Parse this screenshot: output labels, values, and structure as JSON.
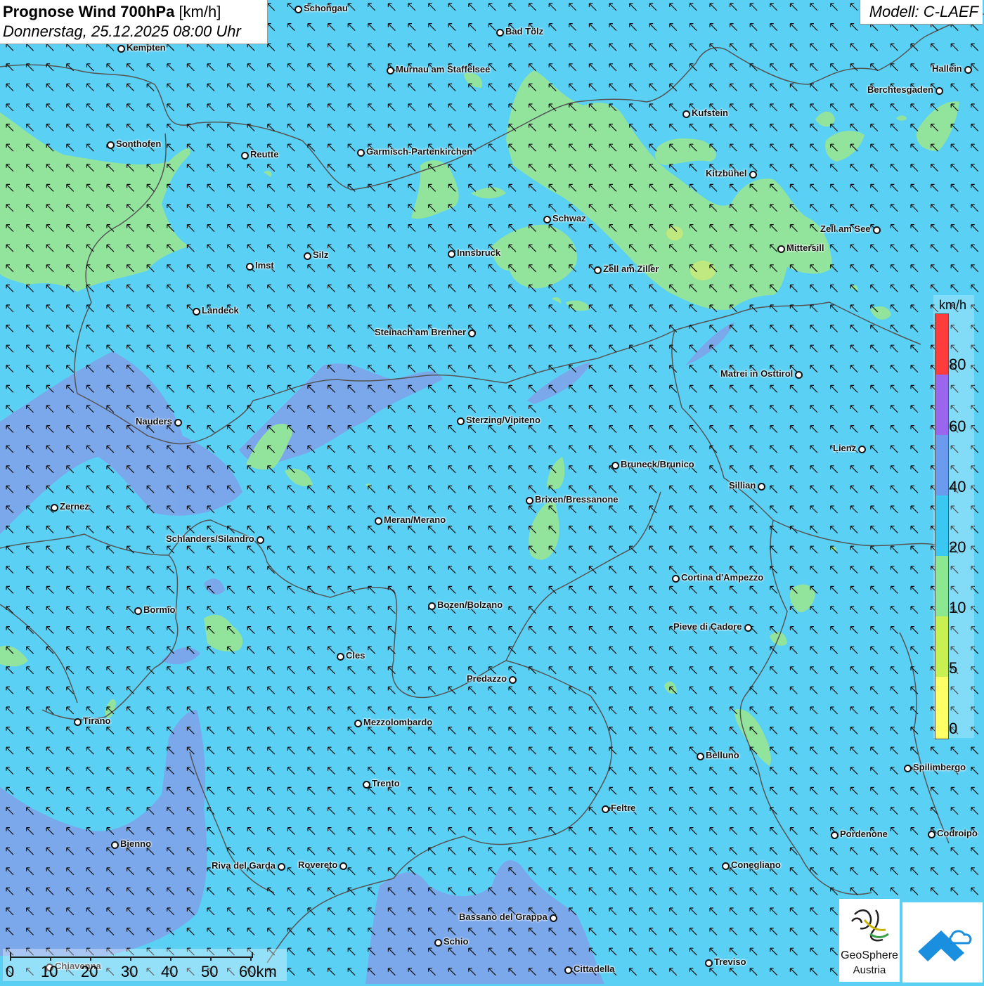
{
  "title": {
    "main_bold": "Prognose Wind 700hPa",
    "unit": "[km/h]",
    "date": "Donnerstag, 25.12.2025 08:00 Uhr"
  },
  "model": "Modell: C-LAEF",
  "legend": {
    "unit": "km/h",
    "bands": [
      {
        "value": 0,
        "color": "#ffff66"
      },
      {
        "value": 5,
        "color": "#ccf055"
      },
      {
        "value": 10,
        "color": "#88e888"
      },
      {
        "value": 20,
        "color": "#33c8f0"
      },
      {
        "value": 40,
        "color": "#6699ee"
      },
      {
        "value": 60,
        "color": "#9966ee"
      },
      {
        "value": 80,
        "color": "#ff4444"
      }
    ],
    "labels": [
      "80",
      "60",
      "40",
      "20",
      "10",
      "5",
      "0"
    ]
  },
  "scale_bar": {
    "labels": [
      "0",
      "10",
      "20",
      "30",
      "40",
      "50",
      "60km"
    ]
  },
  "logos": {
    "geosphere_line1": "GeoSphere",
    "geosphere_line2": "Austria"
  },
  "wind_direction": "from south-east (arrows pointing north-west)",
  "colors": {
    "background_20_40": "#5ad0f5",
    "zone_10_20": "#8fe39a",
    "zone_40_60": "#7e9ee8",
    "border_line": "#555555"
  },
  "cities": [
    {
      "name": "Schongau",
      "lat": 47.81,
      "lon": 10.9
    },
    {
      "name": "Bad Tölz",
      "lat": 47.76,
      "lon": 11.56
    },
    {
      "name": "Kempten",
      "lat": 47.73,
      "lon": 10.32
    },
    {
      "name": "Murnau am Staffelsee",
      "lat": 47.68,
      "lon": 11.2
    },
    {
      "name": "Hallein",
      "lat": 47.68,
      "lon": 13.1
    },
    {
      "name": "Berchtesgaden",
      "lat": 47.63,
      "lon": 13.0
    },
    {
      "name": "Kufstein",
      "lat": 47.58,
      "lon": 12.17
    },
    {
      "name": "Sonthofen",
      "lat": 47.51,
      "lon": 10.28
    },
    {
      "name": "Reutte",
      "lat": 47.49,
      "lon": 10.72
    },
    {
      "name": "Garmisch-Partenkirchen",
      "lat": 47.49,
      "lon": 11.1
    },
    {
      "name": "Kitzbühel",
      "lat": 47.45,
      "lon": 12.39
    },
    {
      "name": "Schwaz",
      "lat": 47.35,
      "lon": 11.71
    },
    {
      "name": "Zell am See",
      "lat": 47.32,
      "lon": 12.8
    },
    {
      "name": "Innsbruck",
      "lat": 47.27,
      "lon": 11.39
    },
    {
      "name": "Mittersill",
      "lat": 47.28,
      "lon": 12.48
    },
    {
      "name": "Silz",
      "lat": 47.27,
      "lon": 10.93
    },
    {
      "name": "Imst",
      "lat": 47.24,
      "lon": 10.74
    },
    {
      "name": "Zell am Ziller",
      "lat": 47.23,
      "lon": 11.88
    },
    {
      "name": "Landeck",
      "lat": 47.14,
      "lon": 10.57
    },
    {
      "name": "Steinach am Brenner",
      "lat": 47.08,
      "lon": 11.47
    },
    {
      "name": "Matrei in Osttirol",
      "lat": 47.0,
      "lon": 12.54
    },
    {
      "name": "Nauders",
      "lat": 46.89,
      "lon": 10.5
    },
    {
      "name": "Sterzing/Vipiteno",
      "lat": 46.9,
      "lon": 11.43
    },
    {
      "name": "Lienz",
      "lat": 46.83,
      "lon": 12.77
    },
    {
      "name": "Bruneck/Brunico",
      "lat": 46.8,
      "lon": 11.94
    },
    {
      "name": "Sillian",
      "lat": 46.75,
      "lon": 12.42
    },
    {
      "name": "Zernez",
      "lat": 46.7,
      "lon": 10.09
    },
    {
      "name": "Brixen/Bressanone",
      "lat": 46.72,
      "lon": 11.66
    },
    {
      "name": "Meran/Merano",
      "lat": 46.67,
      "lon": 11.16
    },
    {
      "name": "Schlanders/Silandro",
      "lat": 46.63,
      "lon": 10.77
    },
    {
      "name": "Cortina d'Ampezzo",
      "lat": 46.54,
      "lon": 12.14
    },
    {
      "name": "Bormio",
      "lat": 46.47,
      "lon": 10.37
    },
    {
      "name": "Bozen/Bolzano",
      "lat": 46.5,
      "lon": 11.35
    },
    {
      "name": "Pieve di Cadore",
      "lat": 46.43,
      "lon": 12.37
    },
    {
      "name": "Cles",
      "lat": 46.36,
      "lon": 11.03
    },
    {
      "name": "Predazzo",
      "lat": 46.31,
      "lon": 11.6
    },
    {
      "name": "Tirano",
      "lat": 46.22,
      "lon": 10.17
    },
    {
      "name": "Mezzolombardo",
      "lat": 46.21,
      "lon": 11.09
    },
    {
      "name": "Belluno",
      "lat": 46.14,
      "lon": 12.22
    },
    {
      "name": "Spilimbergo",
      "lat": 46.11,
      "lon": 12.9
    },
    {
      "name": "Trento",
      "lat": 46.07,
      "lon": 11.12
    },
    {
      "name": "Feltre",
      "lat": 46.02,
      "lon": 11.91
    },
    {
      "name": "Pordenone",
      "lat": 45.96,
      "lon": 12.66
    },
    {
      "name": "Codroipo",
      "lat": 45.96,
      "lon": 12.98
    },
    {
      "name": "Bienno",
      "lat": 45.94,
      "lon": 10.3
    },
    {
      "name": "Riva del Garda",
      "lat": 45.89,
      "lon": 10.84
    },
    {
      "name": "Rovereto",
      "lat": 45.89,
      "lon": 11.04
    },
    {
      "name": "Conegliano",
      "lat": 45.89,
      "lon": 12.3
    },
    {
      "name": "Bassano del Grappa",
      "lat": 45.77,
      "lon": 11.73
    },
    {
      "name": "Schio",
      "lat": 45.71,
      "lon": 11.36
    },
    {
      "name": "Treviso",
      "lat": 45.67,
      "lon": 12.24
    },
    {
      "name": "Cittadella",
      "lat": 45.65,
      "lon": 11.78
    },
    {
      "name": "Chiavenna",
      "lat": 45.64,
      "lon": 10.0
    }
  ]
}
